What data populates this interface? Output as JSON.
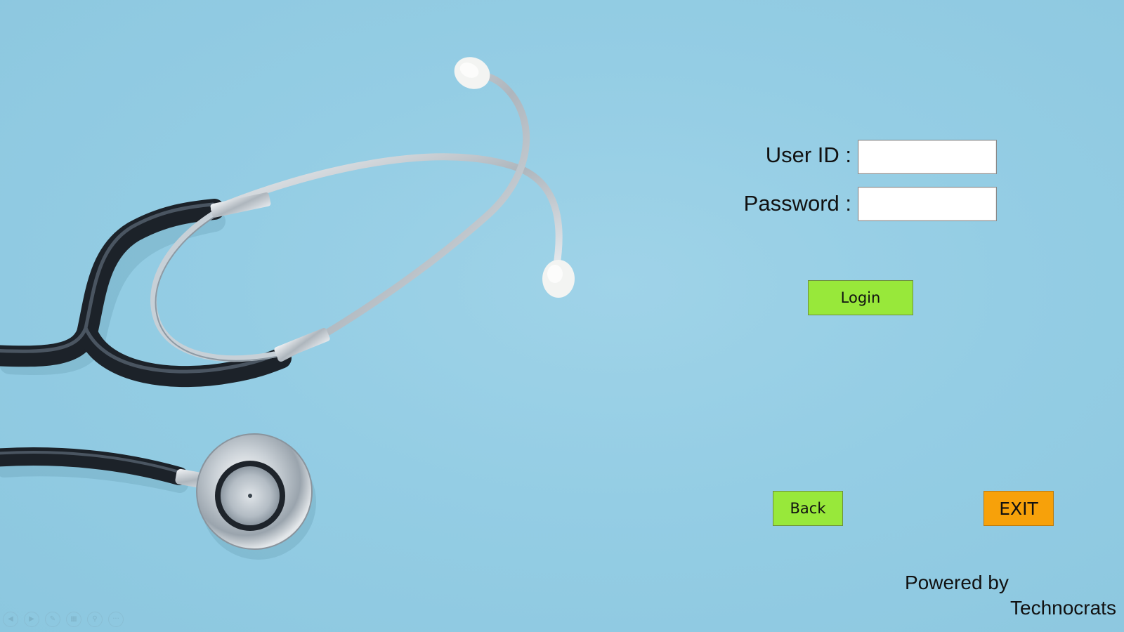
{
  "background": {
    "color": "#94cde4",
    "illustration": "stethoscope"
  },
  "login_form": {
    "user_id_label": "User ID :",
    "user_id_value": "",
    "password_label": "Password :",
    "password_value": "",
    "login_button": "Login"
  },
  "actions": {
    "back_button": "Back",
    "exit_button": "EXIT"
  },
  "footer": {
    "powered_by": "Powered by",
    "company": "Technocrats"
  },
  "slideshow_nav": {
    "icons": [
      "previous-slide-icon",
      "next-slide-icon",
      "pen-icon",
      "slides-grid-icon",
      "zoom-icon",
      "more-options-icon"
    ]
  },
  "colors": {
    "login_button": "#98e83a",
    "back_button": "#98e83a",
    "exit_button": "#f7a10a"
  }
}
